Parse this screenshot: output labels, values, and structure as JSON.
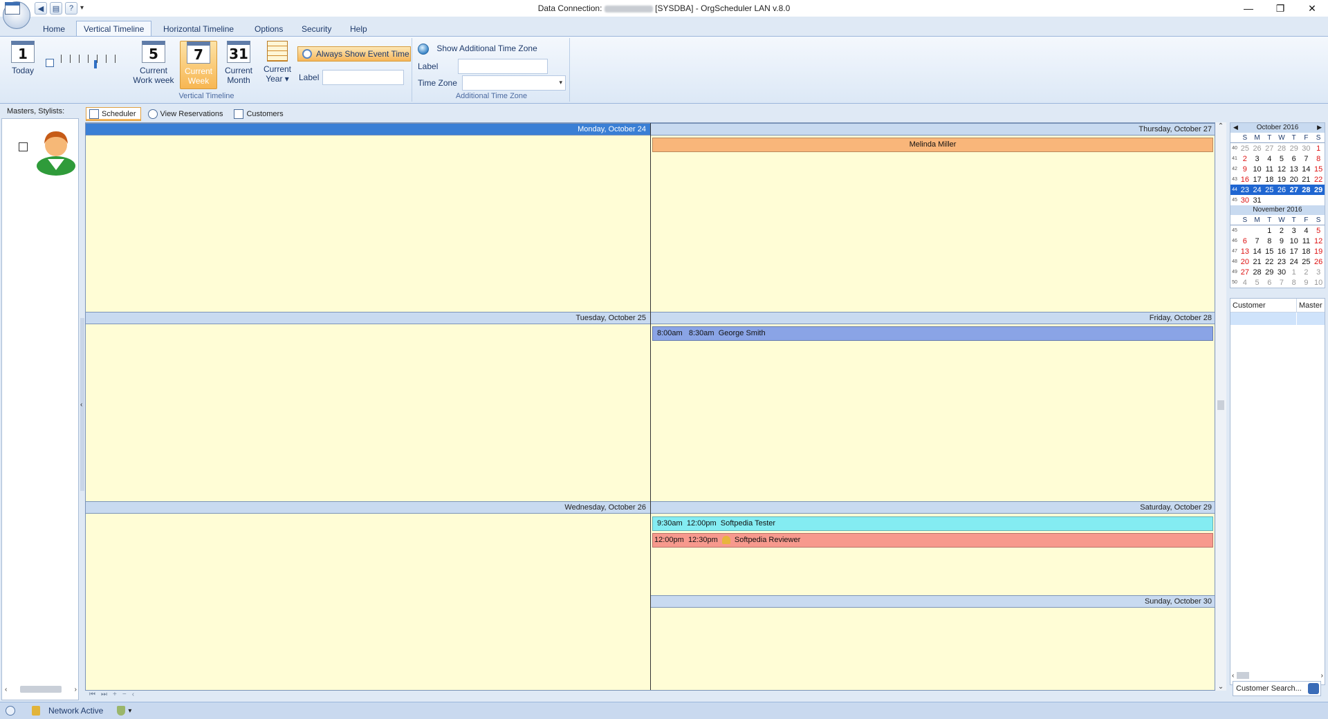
{
  "window": {
    "title_prefix": "Data Connection:",
    "title_suffix": "[SYSDBA] - OrgScheduler LAN v.8.0",
    "minimize": "—",
    "restore": "❐",
    "close": "✕"
  },
  "qat": {
    "dropdown": "▾"
  },
  "ribbon_tabs": [
    "Home",
    "Vertical Timeline",
    "Horizontal Timeline",
    "Options",
    "Security",
    "Help"
  ],
  "ribbon": {
    "vertical_timeline": {
      "caption": "Vertical Timeline",
      "today": {
        "num": "1",
        "label": "Today"
      },
      "work_week": {
        "num": "5",
        "label1": "Current",
        "label2": "Work week"
      },
      "week": {
        "num": "7",
        "label1": "Current",
        "label2": "Week"
      },
      "month": {
        "num": "31",
        "label1": "Current",
        "label2": "Month"
      },
      "year": {
        "label1": "Current",
        "label2": "Year ▾"
      },
      "always_show": "Always Show Event Time",
      "label": "Label"
    },
    "additional_tz": {
      "caption": "Additional Time Zone",
      "show": "Show Additional Time Zone",
      "label": "Label",
      "time_zone": "Time Zone"
    }
  },
  "left_panel": {
    "header": "Masters, Stylists:",
    "scroll_left": "‹",
    "scroll_right": "›"
  },
  "view_tabs": [
    "Scheduler",
    "View Reservations",
    "Customers"
  ],
  "days": {
    "mon": "Monday, October 24",
    "tue": "Tuesday, October 25",
    "wed": "Wednesday, October 26",
    "thu": "Thursday, October 27",
    "fri": "Friday, October 28",
    "sat": "Saturday, October 29",
    "sun": "Sunday, October 30"
  },
  "appointments": {
    "thu1": "Melinda Miller",
    "fri1": {
      "start": "8:00am",
      "end": "8:30am",
      "name": "George Smith"
    },
    "sat1": {
      "start": "9:30am",
      "end": "12:00pm",
      "name": "Softpedia Tester"
    },
    "sat2": {
      "start": "12:00pm",
      "end": "12:30pm",
      "name": "Softpedia Reviewer"
    }
  },
  "scheduler_nav": [
    "⏮",
    "⏭",
    "+",
    "−",
    "‹"
  ],
  "calendar": {
    "weekdays": [
      "S",
      "M",
      "T",
      "W",
      "T",
      "F",
      "S"
    ],
    "october": {
      "title": "October 2016",
      "weeks": [
        {
          "wk": "40",
          "days": [
            "25",
            "26",
            "27",
            "28",
            "29",
            "30",
            "1"
          ]
        },
        {
          "wk": "41",
          "days": [
            "2",
            "3",
            "4",
            "5",
            "6",
            "7",
            "8"
          ]
        },
        {
          "wk": "42",
          "days": [
            "9",
            "10",
            "11",
            "12",
            "13",
            "14",
            "15"
          ]
        },
        {
          "wk": "43",
          "days": [
            "16",
            "17",
            "18",
            "19",
            "20",
            "21",
            "22"
          ]
        },
        {
          "wk": "44",
          "days": [
            "23",
            "24",
            "25",
            "26",
            "27",
            "28",
            "29"
          ]
        },
        {
          "wk": "45",
          "days": [
            "30",
            "31",
            "",
            "",
            "",
            "",
            ""
          ]
        }
      ]
    },
    "november": {
      "title": "November 2016",
      "weeks": [
        {
          "wk": "45",
          "days": [
            "",
            "",
            "1",
            "2",
            "3",
            "4",
            "5"
          ]
        },
        {
          "wk": "46",
          "days": [
            "6",
            "7",
            "8",
            "9",
            "10",
            "11",
            "12"
          ]
        },
        {
          "wk": "47",
          "days": [
            "13",
            "14",
            "15",
            "16",
            "17",
            "18",
            "19"
          ]
        },
        {
          "wk": "48",
          "days": [
            "20",
            "21",
            "22",
            "23",
            "24",
            "25",
            "26"
          ]
        },
        {
          "wk": "49",
          "days": [
            "27",
            "28",
            "29",
            "30",
            "1",
            "2",
            "3"
          ]
        },
        {
          "wk": "50",
          "days": [
            "4",
            "5",
            "6",
            "7",
            "8",
            "9",
            "10"
          ]
        }
      ]
    }
  },
  "customers": {
    "col_customer": "Customer",
    "col_master": "Master",
    "search": "Customer Search..."
  },
  "status": {
    "network": "Network Active",
    "dropdown": "▾"
  },
  "colors": {
    "thu1": "#f9b67a",
    "fri1": "#8aa4e6",
    "sat1": "#84ecf2",
    "sat2": "#f7998d"
  }
}
